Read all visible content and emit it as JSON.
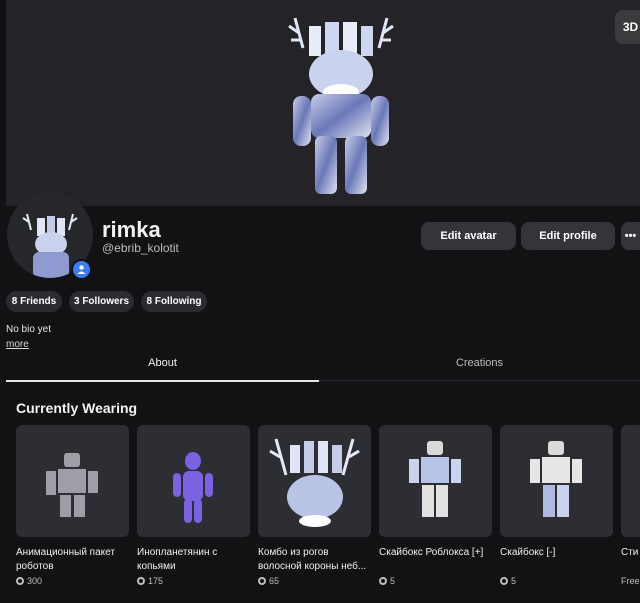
{
  "hero": {
    "view_3d_label": "3D"
  },
  "profile": {
    "display_name": "rimka",
    "username": "@ebrib_kolotit",
    "edit_avatar_label": "Edit avatar",
    "edit_profile_label": "Edit profile",
    "more_menu_label": "•••",
    "friends_label": "8 Friends",
    "followers_label": "3 Followers",
    "following_label": "8 Following",
    "bio": "No bio yet",
    "more_link": "more"
  },
  "tabs": [
    {
      "label": "About",
      "active": true
    },
    {
      "label": "Creations",
      "active": false
    }
  ],
  "wearing": {
    "title": "Currently Wearing",
    "items": [
      {
        "name": "Анимационный пакет роботов",
        "price": "300"
      },
      {
        "name": "Инопланетянин с копьями",
        "price": "175"
      },
      {
        "name": "Комбо из рогов волосной короны неб...",
        "price": "65"
      },
      {
        "name": "Скайбокс Роблокса [+]",
        "price": "5"
      },
      {
        "name": "Скайбокс [-]",
        "price": "5"
      },
      {
        "name": "Сти",
        "price": "Free"
      }
    ]
  },
  "colors": {
    "background": "#121215",
    "card": "#2d2e33",
    "accent": "#3b7df5"
  }
}
